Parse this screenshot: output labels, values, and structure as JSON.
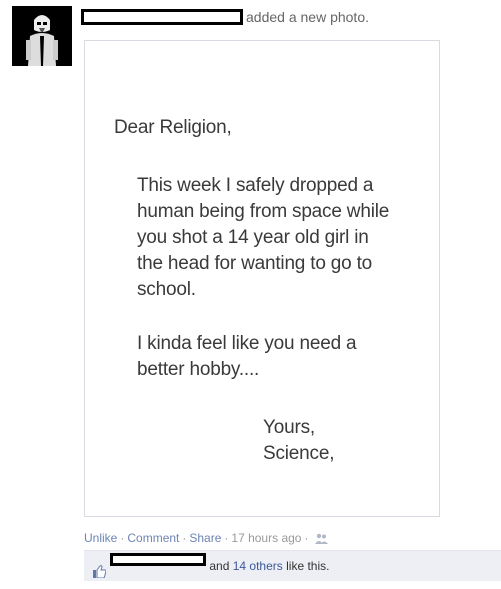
{
  "post": {
    "header_text": "added a new photo."
  },
  "photo": {
    "salutation": "Dear Religion,",
    "paragraph1": "This week I safely dropped a human being from space while you shot a 14 year old girl in the head for wanting to go to school.",
    "paragraph2": "I kinda feel like you need a better hobby....",
    "closing": "Yours,",
    "signature": "Science,"
  },
  "actions": {
    "unlike": "Unlike",
    "comment": "Comment",
    "share": "Share",
    "separator": "·",
    "timestamp": "17 hours ago",
    "audience_icon": "friends-icon"
  },
  "likes": {
    "icon": "thumbs-up-icon",
    "and_text": "and",
    "others_link": "14 others",
    "suffix": "like this."
  },
  "colors": {
    "link": "#6d84b4",
    "likes_bar_bg": "#edeff4",
    "likes_link": "#3b5998",
    "meta_text": "#999999"
  }
}
